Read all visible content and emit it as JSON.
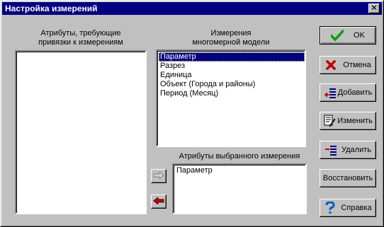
{
  "window": {
    "title": "Настройка измерений",
    "close_glyph": "✕"
  },
  "left_panel": {
    "label_line1": "Атрибуты, требующие",
    "label_line2": "привязки к измерениям",
    "items": []
  },
  "dimensions_panel": {
    "label_line1": "Измерения",
    "label_line2": "многомерной модели",
    "items": [
      "Параметр",
      "Разрез",
      "Единица",
      "Объект (Города и районы)",
      "Период (Месяц)"
    ],
    "selected_index": 0
  },
  "attributes_panel": {
    "label": "Атрибуты выбранного измерения",
    "items": [
      "Параметр"
    ]
  },
  "arrows": {
    "right_icon": "arrow-right-icon",
    "left_icon": "arrow-left-icon"
  },
  "buttons": {
    "ok": "OK",
    "cancel": "Отмена",
    "add": "Добавить",
    "edit": "Изменить",
    "delete": "Удалить",
    "restore": "Восстановить",
    "help": "Справка"
  },
  "colors": {
    "titlebar": "#000080",
    "selection": "#000080",
    "ok_check": "#00a000",
    "cancel_x": "#c00000",
    "arrow_left": "#c00000",
    "help_icon": "#0060c0"
  }
}
